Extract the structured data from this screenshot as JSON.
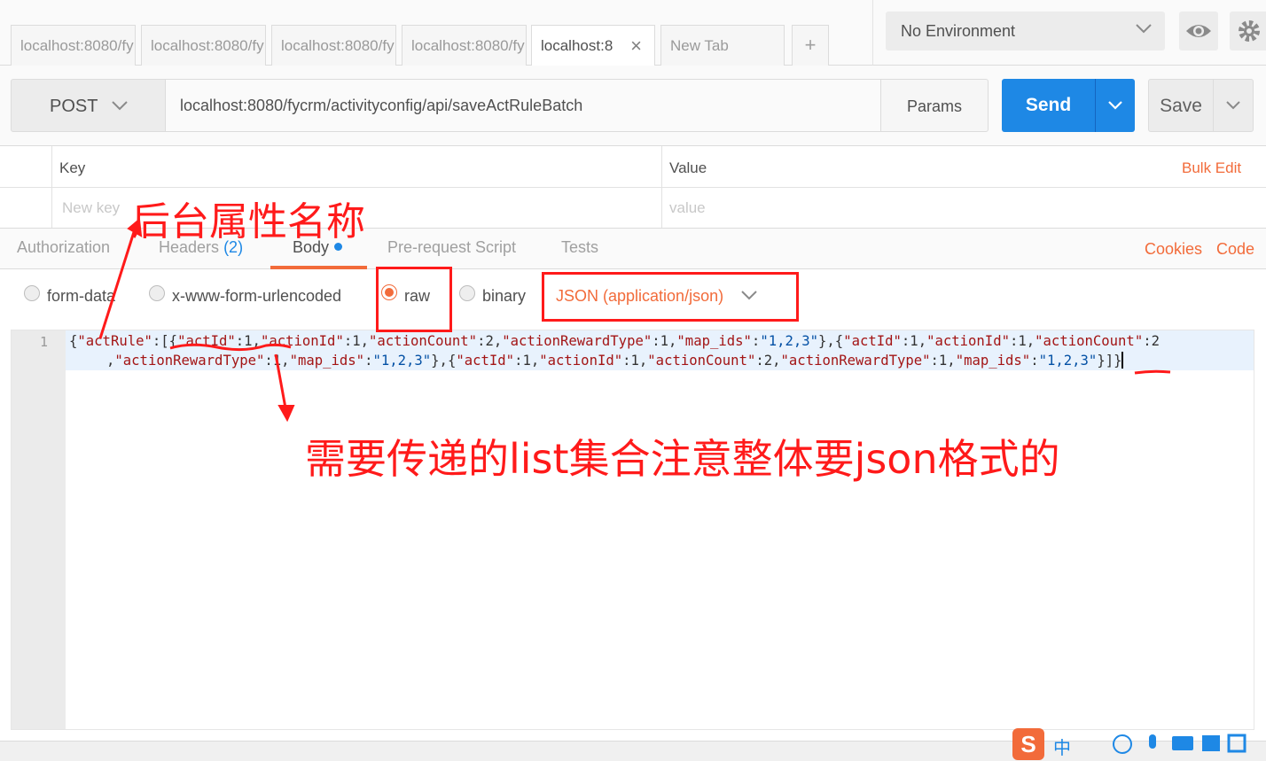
{
  "tabs": [
    {
      "label": "localhost:8080/fy"
    },
    {
      "label": "localhost:8080/fy"
    },
    {
      "label": "localhost:8080/fy"
    },
    {
      "label": "localhost:8080/fy"
    },
    {
      "label": "localhost:8",
      "close": "×"
    },
    {
      "label": "New Tab"
    }
  ],
  "new_tab_icon": "+",
  "environment": {
    "selected": "No Environment"
  },
  "request": {
    "method": "POST",
    "url": "localhost:8080/fycrm/activityconfig/api/saveActRuleBatch",
    "params_label": "Params",
    "send_label": "Send",
    "save_label": "Save"
  },
  "params_table": {
    "key_header": "Key",
    "value_header": "Value",
    "bulk_edit": "Bulk Edit",
    "key_placeholder": "New key",
    "value_placeholder": "value"
  },
  "subtabs": {
    "authorization": "Authorization",
    "headers": "Headers",
    "headers_count": "(2)",
    "body": "Body",
    "prerequest": "Pre-request Script",
    "tests": "Tests",
    "cookies": "Cookies",
    "code": "Code"
  },
  "body_modes": {
    "form_data": "form-data",
    "urlencoded": "x-www-form-urlencoded",
    "raw": "raw",
    "binary": "binary",
    "selected": "raw",
    "content_type": "JSON (application/json)"
  },
  "editor": {
    "line_number": "1",
    "code_line_1": "{\"actRule\":[{\"actId\":1,\"actionId\":1,\"actionCount\":2,\"actionRewardType\":1,\"map_ids\":\"1,2,3\"},{\"actId\":1,\"actionId\":1,\"actionCount\":2",
    "code_line_2": ",\"actionRewardType\":1,\"map_ids\":\"1,2,3\"},{\"actId\":1,\"actionId\":1,\"actionCount\":2,\"actionRewardType\":1,\"map_ids\":\"1,2,3\"}]}"
  },
  "annotations": {
    "top_label": "后台属性名称",
    "bottom_label": "需要传递的list集合注意整体要json格式的",
    "color": "#ff1a1a"
  },
  "colors": {
    "accent_blue": "#1e88e5",
    "accent_orange": "#f26b3a"
  },
  "ime_toolbar": {
    "logo": "S",
    "lang": "中"
  }
}
